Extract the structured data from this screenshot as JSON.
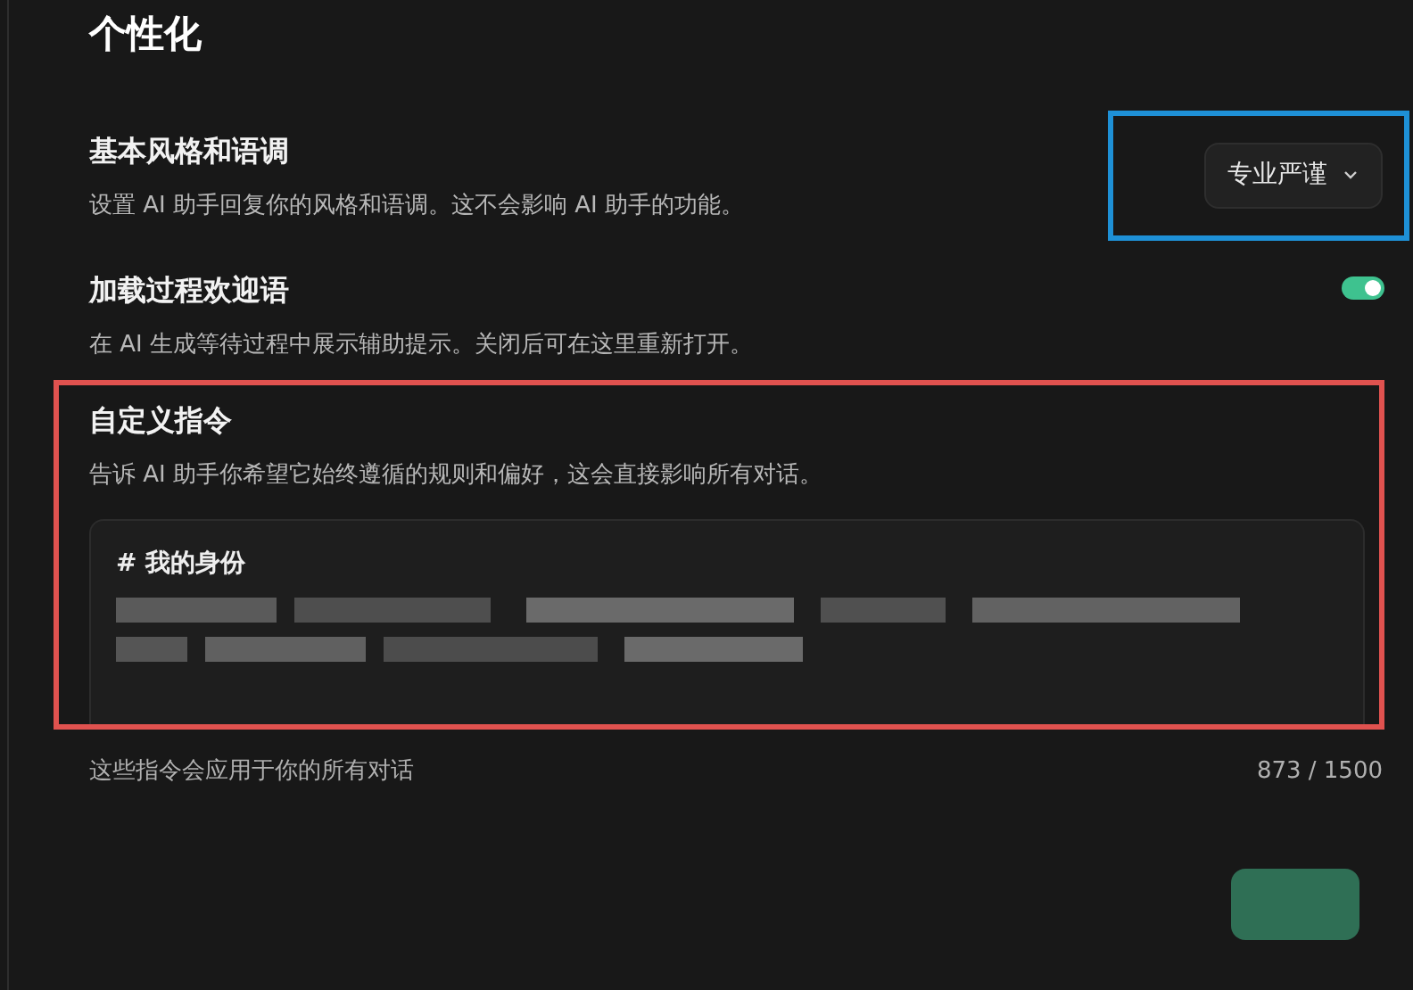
{
  "title": "个性化",
  "settings": [
    {
      "kind": "select",
      "label": "基本风格和语调",
      "description": "设置 AI 助手回复你的风格和语调。这不会影响 AI 助手的功能。",
      "value": "专业严谨",
      "highlighted": true
    },
    {
      "kind": "toggle",
      "label": "加载过程欢迎语",
      "description": "在 AI 生成等待过程中展示辅助提示。关闭后可在这里重新打开。",
      "on": true
    }
  ],
  "custom_instructions": {
    "label": "自定义指令",
    "description": "告诉 AI 助手你希望它始终遵循的规则和偏好，这会直接影响所有对话。",
    "heading": "# 我的身份",
    "highlighted": true,
    "note": "这些指令会应用于你的所有对话",
    "count": "873 / 1500"
  }
}
